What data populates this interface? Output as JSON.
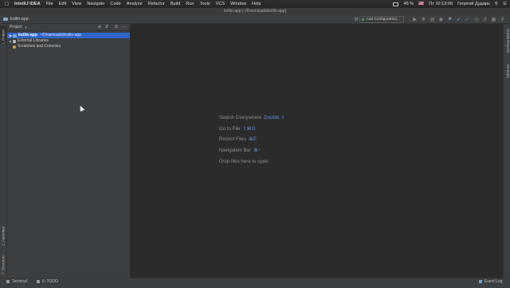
{
  "menubar": {
    "app_name": "IntelliJ IDEA",
    "items": [
      "File",
      "Edit",
      "View",
      "Navigate",
      "Code",
      "Analyze",
      "Refactor",
      "Build",
      "Run",
      "Tools",
      "VCS",
      "Window",
      "Help"
    ],
    "battery": "46 %",
    "flag": "🇺🇸",
    "clock": "Пт 10:13:06",
    "user": "Георгий Дударь"
  },
  "window": {
    "title": "kotlin-app [~/Downloads/kotlin-app]"
  },
  "toolbar": {
    "breadcrumb": "kotlin-app",
    "add_configuration": "Add Configuration..."
  },
  "project_panel": {
    "title": "Project",
    "tree": [
      {
        "label": "kotlin-app",
        "path": "~/Downloads/kotlin-app",
        "icon": "folder-icon",
        "selected": true
      },
      {
        "label": "External Libraries",
        "path": "",
        "icon": "library-icon",
        "selected": false
      },
      {
        "label": "Scratches and Consoles",
        "path": "",
        "icon": "scratch-icon",
        "selected": false
      }
    ]
  },
  "side_tabs": {
    "left": {
      "project": "1: Project",
      "favorites": "2: Favorites",
      "structure": "7: Structure"
    },
    "right": {
      "gradle": "Gradle Projects",
      "ant": "Ant Build"
    }
  },
  "editor_hints": [
    {
      "label": "Search Everywhere",
      "key": "Double ⇧"
    },
    {
      "label": "Go to File",
      "key": "⇧⌘O"
    },
    {
      "label": "Recent Files",
      "key": "⌘E"
    },
    {
      "label": "Navigation Bar",
      "key": "⌘↑"
    },
    {
      "label": "Drop files here to open",
      "key": ""
    }
  ],
  "bottom": {
    "terminal": "Terminal",
    "todo": "6: TODO",
    "event_log": "Event Log"
  },
  "colors": {
    "selection": "#2f65ca",
    "shortcut": "#5d8fd8",
    "editor_bg": "#2b2b2b",
    "panel_bg": "#3c3f41"
  }
}
